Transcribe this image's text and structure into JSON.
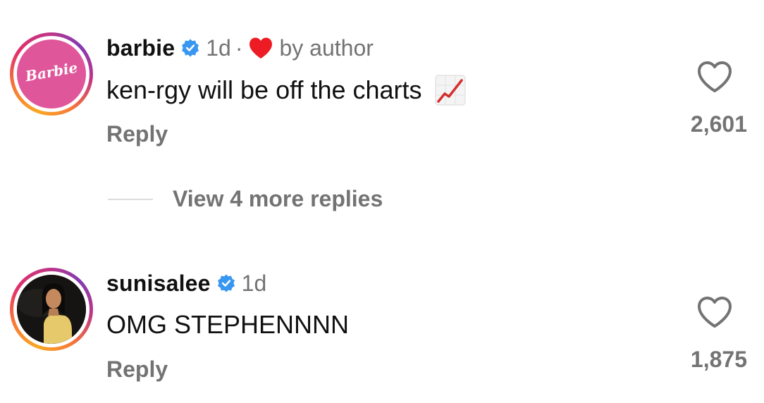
{
  "comments": [
    {
      "username": "barbie",
      "verified": true,
      "age": "1d",
      "separator": "·",
      "author_liked": true,
      "author_badge": "by author",
      "text": "ken-rgy will be off the charts",
      "emoji": "chart-increasing-icon",
      "reply_label": "Reply",
      "likes": "2,601",
      "avatar_logo_text": "Barbie"
    },
    {
      "username": "sunisalee",
      "verified": true,
      "age": "1d",
      "text": "OMG STEPHENNNN",
      "reply_label": "Reply",
      "likes": "1,875"
    }
  ],
  "view_replies_label": "View 4 more replies",
  "colors": {
    "verified_blue": "#3897f0",
    "heart_red": "#ed1c24",
    "muted_text": "#737373",
    "barbie_pink": "#e0569a"
  }
}
